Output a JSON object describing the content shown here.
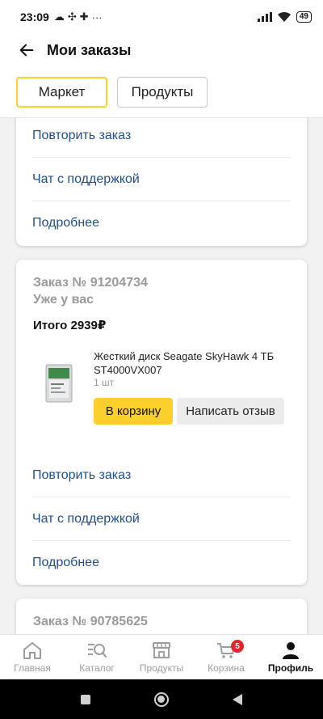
{
  "status_bar": {
    "time": "23:09",
    "icons": [
      "cloud-icon",
      "fan-icon",
      "puzzle-icon",
      "more-dots-icon"
    ],
    "right_icons": [
      "signal-icon",
      "wifi-icon"
    ],
    "battery": "49"
  },
  "header": {
    "title": "Мои заказы"
  },
  "tabs": [
    {
      "label": "Маркет",
      "active": true
    },
    {
      "label": "Продукты",
      "active": false
    }
  ],
  "card1": {
    "actions": [
      "Повторить заказ",
      "Чат с поддержкой",
      "Подробнее"
    ]
  },
  "card2": {
    "order_number": "Заказ № 91204734",
    "status": "Уже у вас",
    "total": "Итого 2939₽",
    "product": {
      "name": "Жесткий диск Seagate SkyHawk 4 ТБ ST4000VX007",
      "quantity": "1 шт"
    },
    "cart_button": "В корзину",
    "review_button": "Написать отзыв",
    "actions": [
      "Повторить заказ",
      "Чат с поддержкой",
      "Подробнее"
    ]
  },
  "card3": {
    "order_number": "Заказ № 90785625"
  },
  "bottom_nav": [
    {
      "label": "Главная",
      "icon": "home-icon"
    },
    {
      "label": "Каталог",
      "icon": "catalog-search-icon"
    },
    {
      "label": "Продукты",
      "icon": "grocery-store-icon"
    },
    {
      "label": "Корзина",
      "icon": "cart-icon",
      "badge": "5"
    },
    {
      "label": "Профиль",
      "icon": "profile-icon",
      "active": true
    }
  ],
  "colors": {
    "accent_yellow": "#fcd02a",
    "link_blue": "#1d4f91",
    "badge_red": "#e4252c"
  }
}
